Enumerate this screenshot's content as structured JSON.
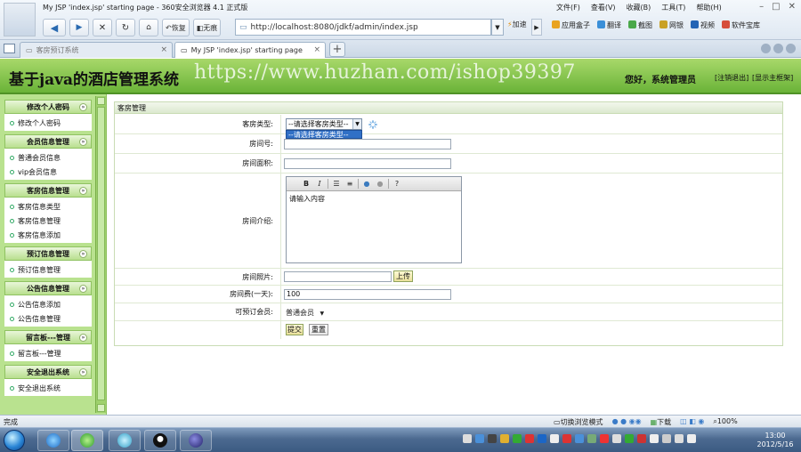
{
  "browser": {
    "window_title": "My JSP 'index.jsp' starting page - 360安全浏览器 4.1 正式版",
    "menus": [
      "文件(F)",
      "查看(V)",
      "收藏(B)",
      "工具(T)",
      "帮助(H)"
    ],
    "back_label": "",
    "restore_label": "恢复",
    "no_trace_label": "无痕",
    "address": "http://localhost:8080/jdkf/admin/index.jsp",
    "accelerate_label": "加速",
    "toolbar_items": [
      "应用盒子",
      "翻译",
      "截图",
      "网银",
      "视频",
      "软件宝库"
    ],
    "tabs": [
      {
        "label": "客房预订系统",
        "active": false
      },
      {
        "label": "My JSP 'index.jsp' starting page",
        "active": true
      }
    ]
  },
  "header": {
    "site_title": "基于java的酒店管理系统",
    "watermark": "https://www.huzhan.com/ishop39397",
    "greeting": "您好，系统管理员",
    "logout": "[注销退出]",
    "home": "[显示主框架]"
  },
  "sidebar": {
    "sections": [
      {
        "title": "修改个人密码",
        "items": [
          "修改个人密码"
        ]
      },
      {
        "title": "会员信息管理",
        "items": [
          "普通会员信息",
          "vip会员信息"
        ]
      },
      {
        "title": "客房信息管理",
        "items": [
          "客房信息类型",
          "客房信息管理",
          "客房信息添加"
        ]
      },
      {
        "title": "预订信息管理",
        "items": [
          "预订信息管理"
        ]
      },
      {
        "title": "公告信息管理",
        "items": [
          "公告信息添加",
          "公告信息管理"
        ]
      },
      {
        "title": "留言板---管理",
        "items": [
          "留言板---管理"
        ]
      },
      {
        "title": "安全退出系统",
        "items": [
          "安全退出系统"
        ]
      }
    ]
  },
  "form": {
    "panel_title": "客房管理",
    "room_type_label": "客房类型:",
    "room_type_value": "--请选择客房类型--",
    "room_type_option": "--请选择客房类型--",
    "room_no_label": "房间号:",
    "room_no_value": "",
    "area_label": "房间面积:",
    "area_value": "",
    "intro_label": "房间介绍:",
    "intro_value": "请输入内容",
    "photo_label": "房间照片:",
    "upload_button": "上传",
    "price_label": "房间费(一天):",
    "price_value": "100",
    "member_label": "可预订会员:",
    "member_value": "普通会员",
    "submit_button": "提交",
    "reset_button": "重置",
    "editor_buttons": [
      "B",
      "I"
    ]
  },
  "status": {
    "text": "完成",
    "right_items": [
      "切换浏览模式",
      "下载",
      "100%"
    ]
  },
  "taskbar": {
    "time": "13:00",
    "date": "2012/5/16"
  }
}
